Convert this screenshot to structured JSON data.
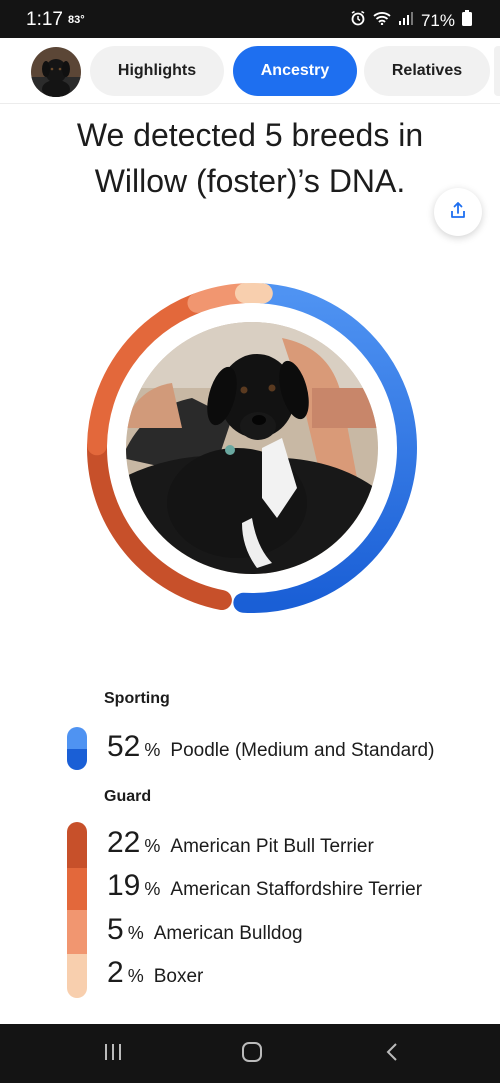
{
  "status_bar": {
    "time": "1:17",
    "temperature": "83°",
    "battery": "71%"
  },
  "tabs": [
    {
      "label": "Highlights",
      "active": false
    },
    {
      "label": "Ancestry",
      "active": true
    },
    {
      "label": "Relatives",
      "active": false
    }
  ],
  "headline": "We detected 5 breeds in Willow (foster)’s DNA.",
  "groups": {
    "sporting": "Sporting",
    "guard": "Guard"
  },
  "breeds": [
    {
      "percent": "52",
      "name": "Poodle (Medium and Standard)",
      "group": "Sporting",
      "color": "#2a72e6"
    },
    {
      "percent": "22",
      "name": "American Pit Bull Terrier",
      "group": "Guard",
      "color": "#c7502a"
    },
    {
      "percent": "19",
      "name": "American Staffordshire Terrier",
      "group": "Guard",
      "color": "#e3683b"
    },
    {
      "percent": "5",
      "name": "American Bulldog",
      "group": "Guard",
      "color": "#f19670"
    },
    {
      "percent": "2",
      "name": "Boxer",
      "group": "Guard",
      "color": "#f8cfae"
    }
  ],
  "percent_sign": "%",
  "colors": {
    "accent": "#1e6ff0",
    "sporting_dark": "#1a5fd6",
    "sporting_light": "#4f93f2",
    "guard_dark": "#c4471f",
    "guard_light": "#f6c39e"
  },
  "icons": {
    "share": "share-icon",
    "nav_recent": "recent-apps-icon",
    "nav_home": "home-icon",
    "nav_back": "back-icon"
  }
}
